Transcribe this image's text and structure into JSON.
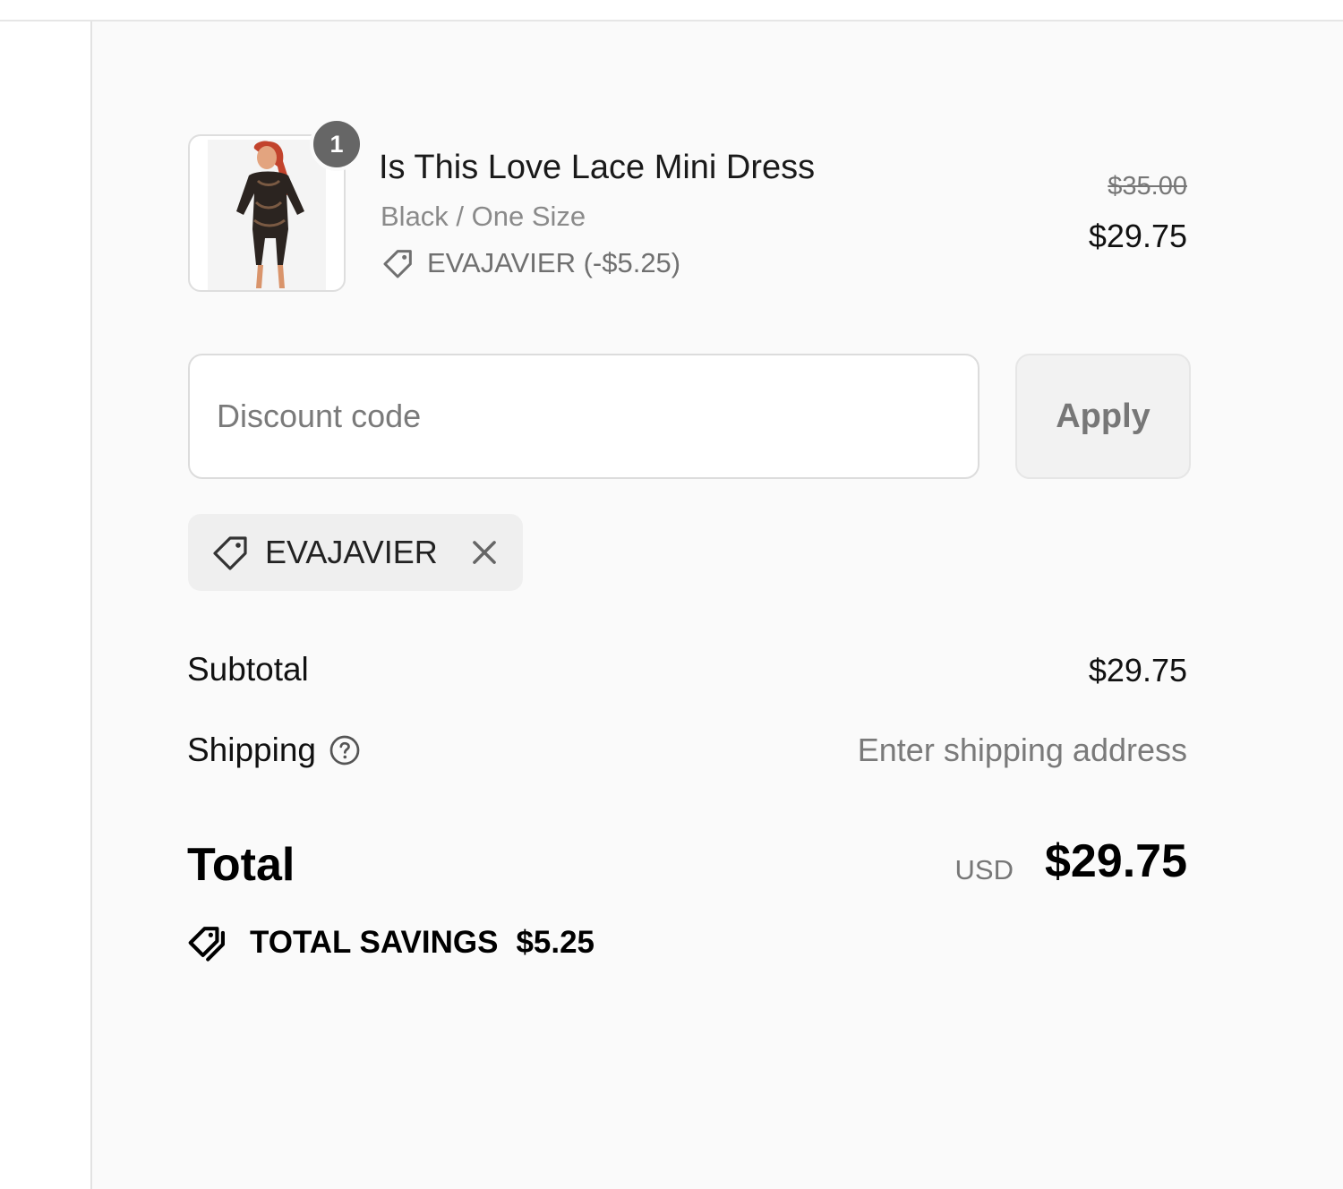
{
  "line_item": {
    "quantity": "1",
    "title": "Is This Love Lace Mini Dress",
    "variant": "Black / One Size",
    "discount": "EVAJAVIER (-$5.25)",
    "original_price": "$35.00",
    "final_price": "$29.75"
  },
  "discount_form": {
    "placeholder": "Discount code",
    "apply_label": "Apply"
  },
  "applied_code": {
    "code": "EVAJAVIER"
  },
  "totals": {
    "subtotal_label": "Subtotal",
    "subtotal_value": "$29.75",
    "shipping_label": "Shipping",
    "shipping_value": "Enter shipping address",
    "total_label": "Total",
    "currency": "USD",
    "total_value": "$29.75",
    "savings_label": "TOTAL SAVINGS",
    "savings_value": "$5.25"
  },
  "icons": {
    "tag": "tag-icon",
    "remove": "close-icon",
    "help": "help-circle-icon",
    "savings": "double-tag-icon"
  },
  "colors": {
    "badge": "#666666",
    "muted_text": "#7a7a7a",
    "panel_bg": "#fafafa"
  }
}
